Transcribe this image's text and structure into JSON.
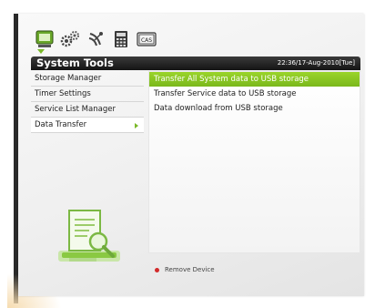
{
  "title": "System Tools",
  "clock": "22:36/17-Aug-2010[Tue]",
  "icons": [
    {
      "name": "system-tools-icon"
    },
    {
      "name": "settings-gears-icon"
    },
    {
      "name": "satellite-icon"
    },
    {
      "name": "calculator-icon"
    },
    {
      "name": "cas-icon",
      "label": "CAS"
    }
  ],
  "left_menu": {
    "items": [
      {
        "label": "Storage Manager"
      },
      {
        "label": "Timer Settings"
      },
      {
        "label": "Service List Manager"
      },
      {
        "label": "Data Transfer",
        "selected": true
      }
    ]
  },
  "options": {
    "items": [
      {
        "label": "Transfer All System data to USB storage",
        "active": true
      },
      {
        "label": "Transfer Service data to USB storage"
      },
      {
        "label": "Data download from USB storage"
      }
    ]
  },
  "footer": {
    "remove_label": "Remove Device",
    "remove_color": "#d22a2a"
  },
  "colors": {
    "accent": "#8ac924",
    "titlebar": "#1e1e1e"
  }
}
